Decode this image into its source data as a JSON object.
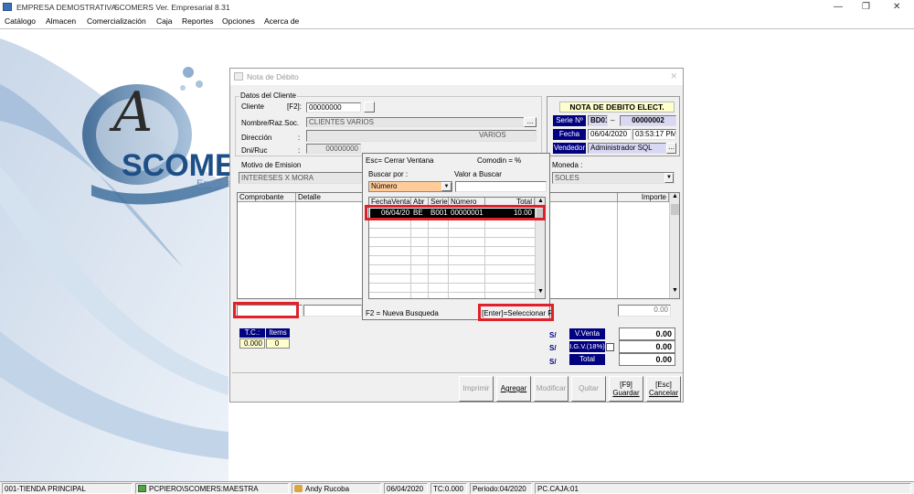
{
  "window": {
    "company": "EMPRESA DEMOSTRATIVA",
    "title": "SCOMERS Ver. Empresarial  8.31",
    "min": "—",
    "restore": "❐",
    "close": "✕"
  },
  "menu": [
    "Catálogo",
    "Almacen",
    "Comercialización",
    "Caja",
    "Reportes",
    "Opciones",
    "Acerca de"
  ],
  "logo": {
    "text": "SCOMER",
    "sub": "Empres",
    "mono": "A"
  },
  "dialog": {
    "title": "Nota de Débito",
    "close": "✕",
    "client_group": "Datos del Cliente",
    "cliente_label": "Cliente",
    "f2_label": "[F2]:",
    "cliente_value": "00000000",
    "nombre_label": "Nombre/Raz.Soc.",
    "nombre_value": "CLIENTES VARIOS",
    "ellipsis": "...",
    "direccion_label": "Dirección",
    "direccion_value": "VARIOS",
    "dni_label": "Dni/Ruc",
    "dni_value": "00000000",
    "colon": ":",
    "doc_title": "NOTA DE DEBITO ELECT.",
    "doc_subtitle": "BD01",
    "serie_label": "Serie Nº",
    "serie_value": "BD01",
    "dash": "–",
    "numero_value": "00000002",
    "fecha_label": "Fecha",
    "fecha_value": "06/04/2020",
    "hora_value": "03:53:17 PM",
    "vendedor_label": "Vendedor",
    "vendedor_value": "Administrador SQL",
    "motivo_label": "Motivo de Emision",
    "motivo_value": "INTERESES X MORA",
    "moneda_label": "Moneda :",
    "moneda_value": "SOLES",
    "grid_cols": [
      "Comprobante",
      "Detalle",
      "Importe"
    ],
    "importe_total": "0.00",
    "tc_label": "T.C.:",
    "items_label": "Items",
    "tc_value": "0.000",
    "items_value": "0",
    "currency": "S/",
    "vventa_label": "V.Venta",
    "vventa_value": "0.00",
    "igv_label": "I.G.V.(18%)",
    "igv_value": "0.00",
    "total_label": "Total",
    "total_value": "0.00",
    "buttons": {
      "imprimir": "Imprimir",
      "agregar": "Agregar",
      "modificar": "Modificar",
      "quitar": "Quitar",
      "guardar_key": "[F9]",
      "guardar": "Guardar",
      "cancelar_key": "[Esc]",
      "cancelar": "Cancelar"
    }
  },
  "popup": {
    "esc": "Esc= Cerrar Ventana",
    "comodin": "Comodin = %",
    "buscar_label": "Buscar por :",
    "valor_label": "Valor a Buscar",
    "buscar_value": "Número",
    "cols": [
      "FechaVenta",
      "Abr",
      "Serie",
      "Número",
      "Total"
    ],
    "rows": [
      {
        "fecha": "06/04/20",
        "abr": "BE",
        "serie": "B001",
        "numero": "00000001",
        "total": "10.00"
      }
    ],
    "footer_left": "F2 = Nueva Busqueda",
    "footer_right": "[Enter]=Seleccionar R"
  },
  "status": {
    "tienda": "001-TIENDA PRINCIPAL",
    "db": "PCPIERO\\SCOMERS:MAESTRA",
    "user": "Andy Rucoba",
    "date": "06/04/2020",
    "tc": "TC:0.000",
    "periodo": "Periodo:04/2020",
    "caja": "PC.CAJA:01"
  },
  "colors": {
    "navy": "#000080",
    "highlight": "#ffcc99",
    "red_box": "#e0202a",
    "selected_row": "#000000"
  }
}
